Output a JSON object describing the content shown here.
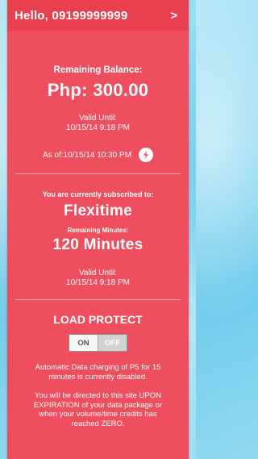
{
  "header": {
    "greeting": "Hello, 09199999999",
    "chevron": ">"
  },
  "balance": {
    "label": "Remaining Balance:",
    "value": "Php: 300.00",
    "valid_label": "Valid Until:",
    "valid_date": "10/15/14 9:18 PM",
    "as_of": "As of:10/15/14 10:30 PM"
  },
  "subscription": {
    "label": "You are currently subscribed to:",
    "plan": "Flexitime",
    "minutes_label": "Remaining Minutes:",
    "minutes_value": "120 Minutes",
    "valid_label": "Valid Until:",
    "valid_date": "10/15/14 9:18 PM"
  },
  "load_protect": {
    "title": "LOAD PROTECT",
    "toggle_on": "ON",
    "toggle_off": "OFF",
    "state": "off",
    "message_1": "Automatic Data charging of P5 for 15 minutes is currently disabled.",
    "message_2": "You will be directed to this site UPON EXPIRATION of your data package or when your volume/time credits has reached ZERO."
  },
  "icons": {
    "refresh": "refresh-icon",
    "chevron": "chevron-right-icon"
  },
  "colors": {
    "panel": "#ee4e5e",
    "header": "#e8404f",
    "background": "#7fd3ee",
    "refresh_icon": "#ee4e5e"
  }
}
